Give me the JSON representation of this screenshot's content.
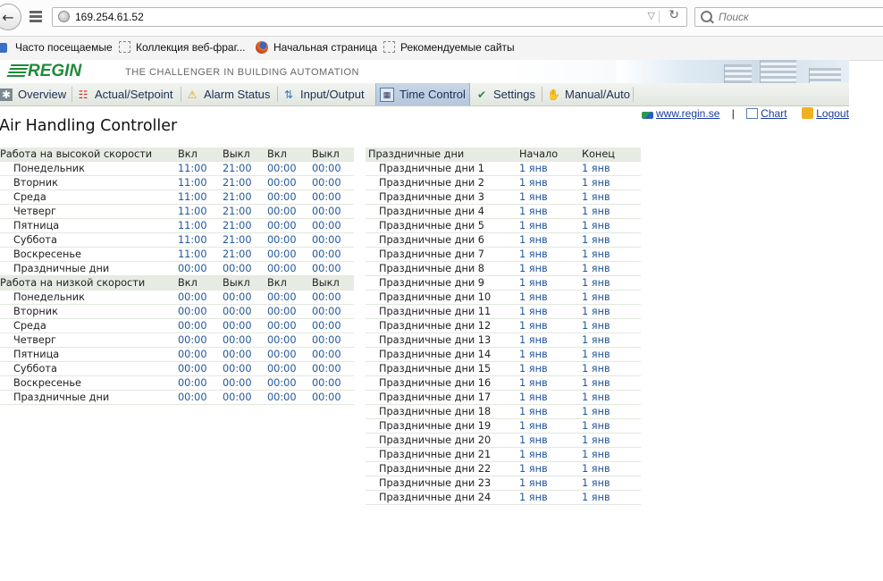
{
  "browser": {
    "url": "169.254.61.52",
    "search_placeholder": "Поиск",
    "bookmarks": [
      "Часто посещаемые",
      "Коллекция веб-фраг...",
      "Начальная страница",
      "Рекомендуемые сайты"
    ]
  },
  "header": {
    "logo": "REGIN",
    "tagline": "THE CHALLENGER IN BUILDING AUTOMATION"
  },
  "nav": {
    "items": [
      "Overview",
      "Actual/Setpoint",
      "Alarm Status",
      "Input/Output",
      "Time Control",
      "Settings",
      "Manual/Auto"
    ],
    "active": "Time Control"
  },
  "links": {
    "site": "www.regin.se",
    "separator": "|",
    "chart": "Chart",
    "logout": "Logout"
  },
  "page_title": "Air Handling Controller",
  "schedule": {
    "columns": [
      "Вкл",
      "Выкл",
      "Вкл",
      "Выкл"
    ],
    "high": {
      "title": "Работа на высокой скорости",
      "rows": [
        {
          "day": "Понедельник",
          "values": [
            "11:00",
            "21:00",
            "00:00",
            "00:00"
          ]
        },
        {
          "day": "Вторник",
          "values": [
            "11:00",
            "21:00",
            "00:00",
            "00:00"
          ]
        },
        {
          "day": "Среда",
          "values": [
            "11:00",
            "21:00",
            "00:00",
            "00:00"
          ]
        },
        {
          "day": "Четверг",
          "values": [
            "11:00",
            "21:00",
            "00:00",
            "00:00"
          ]
        },
        {
          "day": "Пятница",
          "values": [
            "11:00",
            "21:00",
            "00:00",
            "00:00"
          ]
        },
        {
          "day": "Суббота",
          "values": [
            "11:00",
            "21:00",
            "00:00",
            "00:00"
          ]
        },
        {
          "day": "Воскресенье",
          "values": [
            "11:00",
            "21:00",
            "00:00",
            "00:00"
          ]
        },
        {
          "day": "Праздничные дни",
          "values": [
            "00:00",
            "00:00",
            "00:00",
            "00:00"
          ]
        }
      ]
    },
    "low": {
      "title": "Работа на низкой скорости",
      "rows": [
        {
          "day": "Понедельник",
          "values": [
            "00:00",
            "00:00",
            "00:00",
            "00:00"
          ]
        },
        {
          "day": "Вторник",
          "values": [
            "00:00",
            "00:00",
            "00:00",
            "00:00"
          ]
        },
        {
          "day": "Среда",
          "values": [
            "00:00",
            "00:00",
            "00:00",
            "00:00"
          ]
        },
        {
          "day": "Четверг",
          "values": [
            "00:00",
            "00:00",
            "00:00",
            "00:00"
          ]
        },
        {
          "day": "Пятница",
          "values": [
            "00:00",
            "00:00",
            "00:00",
            "00:00"
          ]
        },
        {
          "day": "Суббота",
          "values": [
            "00:00",
            "00:00",
            "00:00",
            "00:00"
          ]
        },
        {
          "day": "Воскресенье",
          "values": [
            "00:00",
            "00:00",
            "00:00",
            "00:00"
          ]
        },
        {
          "day": "Праздничные дни",
          "values": [
            "00:00",
            "00:00",
            "00:00",
            "00:00"
          ]
        }
      ]
    }
  },
  "holidays": {
    "title": "Праздничные дни",
    "col_start": "Начало",
    "col_end": "Конец",
    "rows": [
      {
        "name": "Праздничные дни 1",
        "start": "1 янв",
        "end": "1 янв"
      },
      {
        "name": "Праздничные дни 2",
        "start": "1 янв",
        "end": "1 янв"
      },
      {
        "name": "Праздничные дни 3",
        "start": "1 янв",
        "end": "1 янв"
      },
      {
        "name": "Праздничные дни 4",
        "start": "1 янв",
        "end": "1 янв"
      },
      {
        "name": "Праздничные дни 5",
        "start": "1 янв",
        "end": "1 янв"
      },
      {
        "name": "Праздничные дни 6",
        "start": "1 янв",
        "end": "1 янв"
      },
      {
        "name": "Праздничные дни 7",
        "start": "1 янв",
        "end": "1 янв"
      },
      {
        "name": "Праздничные дни 8",
        "start": "1 янв",
        "end": "1 янв"
      },
      {
        "name": "Праздничные дни 9",
        "start": "1 янв",
        "end": "1 янв"
      },
      {
        "name": "Праздничные дни 10",
        "start": "1 янв",
        "end": "1 янв"
      },
      {
        "name": "Праздничные дни 11",
        "start": "1 янв",
        "end": "1 янв"
      },
      {
        "name": "Праздничные дни 12",
        "start": "1 янв",
        "end": "1 янв"
      },
      {
        "name": "Праздничные дни 13",
        "start": "1 янв",
        "end": "1 янв"
      },
      {
        "name": "Праздничные дни 14",
        "start": "1 янв",
        "end": "1 янв"
      },
      {
        "name": "Праздничные дни 15",
        "start": "1 янв",
        "end": "1 янв"
      },
      {
        "name": "Праздничные дни 16",
        "start": "1 янв",
        "end": "1 янв"
      },
      {
        "name": "Праздничные дни 17",
        "start": "1 янв",
        "end": "1 янв"
      },
      {
        "name": "Праздничные дни 18",
        "start": "1 янв",
        "end": "1 янв"
      },
      {
        "name": "Праздничные дни 19",
        "start": "1 янв",
        "end": "1 янв"
      },
      {
        "name": "Праздничные дни 20",
        "start": "1 янв",
        "end": "1 янв"
      },
      {
        "name": "Праздничные дни 21",
        "start": "1 янв",
        "end": "1 янв"
      },
      {
        "name": "Праздничные дни 22",
        "start": "1 янв",
        "end": "1 янв"
      },
      {
        "name": "Праздничные дни 23",
        "start": "1 янв",
        "end": "1 янв"
      },
      {
        "name": "Праздничные дни 24",
        "start": "1 янв",
        "end": "1 янв"
      }
    ]
  },
  "colors": {
    "value_blue": "#24579a",
    "logo_green": "#1f8a3a",
    "nav_text": "#1a2f55",
    "link": "#1a3b9a"
  }
}
